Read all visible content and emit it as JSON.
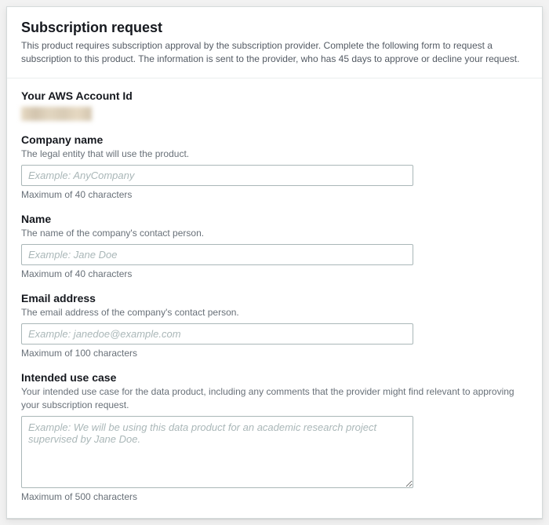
{
  "header": {
    "title": "Subscription request",
    "description": "This product requires subscription approval by the subscription provider. Complete the following form to request a subscription to this product. The information is sent to the provider, who has 45 days to approve or decline your request."
  },
  "accountId": {
    "label": "Your AWS Account Id"
  },
  "companyName": {
    "label": "Company name",
    "hint": "The legal entity that will use the product.",
    "placeholder": "Example: AnyCompany",
    "constraint": "Maximum of 40 characters"
  },
  "name": {
    "label": "Name",
    "hint": "The name of the company's contact person.",
    "placeholder": "Example: Jane Doe",
    "constraint": "Maximum of 40 characters"
  },
  "email": {
    "label": "Email address",
    "hint": "The email address of the company's contact person.",
    "placeholder": "Example: janedoe@example.com",
    "constraint": "Maximum of 100 characters"
  },
  "useCase": {
    "label": "Intended use case",
    "hint": "Your intended use case for the data product, including any comments that the provider might find relevant to approving your subscription request.",
    "placeholder": "Example: We will be using this data product for an academic research project supervised by Jane Doe.",
    "constraint": "Maximum of 500 characters"
  }
}
